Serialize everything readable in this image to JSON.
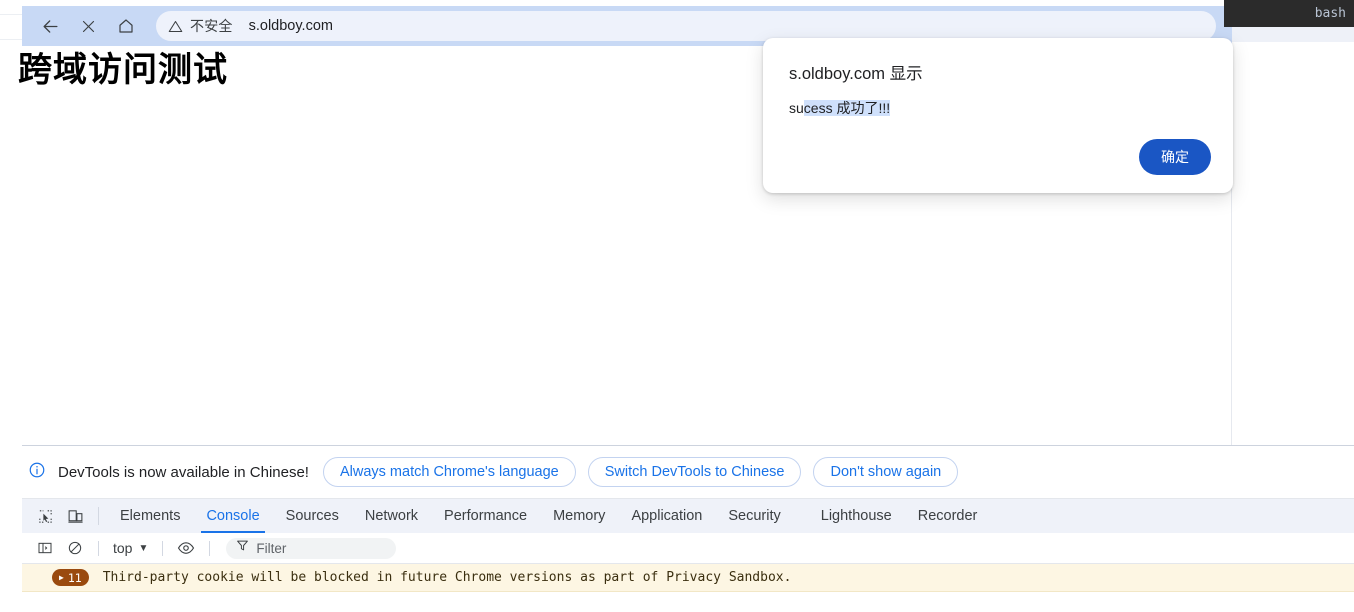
{
  "browser": {
    "back_icon": "back-arrow-icon",
    "close_icon": "close-icon",
    "home_icon": "home-icon",
    "security_icon": "warning-triangle-icon",
    "security_label": "不安全",
    "url": "s.oldboy.com",
    "toolbar_color": "#c8d9f5"
  },
  "terminal_overlay": {
    "label": "bash",
    "background": "#2b2b2b"
  },
  "page": {
    "title": "跨域访问测试"
  },
  "dialog": {
    "origin_line": "s.oldboy.com 显示",
    "message_plain": "su",
    "message_selected": "cess 成功了!!!",
    "message_full": "sucess 成功了!!!",
    "ok_label": "确定",
    "ok_color": "#1a56c4",
    "selection_color": "#cfe0fb"
  },
  "devtools": {
    "notice": {
      "icon": "info-circle-icon",
      "text": "DevTools is now available in Chinese!",
      "buttons": [
        {
          "label": "Always match Chrome's language"
        },
        {
          "label": "Switch DevTools to Chinese"
        },
        {
          "label": "Don't show again"
        }
      ]
    },
    "toolbar_icons": [
      {
        "name": "inspect-element-icon"
      },
      {
        "name": "device-toolbar-icon"
      }
    ],
    "tabs": [
      {
        "label": "Elements",
        "active": false
      },
      {
        "label": "Console",
        "active": true
      },
      {
        "label": "Sources",
        "active": false
      },
      {
        "label": "Network",
        "active": false
      },
      {
        "label": "Performance",
        "active": false
      },
      {
        "label": "Memory",
        "active": false
      },
      {
        "label": "Application",
        "active": false
      },
      {
        "label": "Security",
        "active": false
      },
      {
        "label": "Lighthouse",
        "active": false
      },
      {
        "label": "Recorder",
        "active": false
      }
    ],
    "console_bar": {
      "sidebar_icon": "console-sidebar-icon",
      "clear_icon": "clear-console-icon",
      "context": "top",
      "context_caret": "▼",
      "eye_icon": "live-expression-eye-icon",
      "filter_icon": "funnel-filter-icon",
      "filter_placeholder": "Filter"
    },
    "messages": [
      {
        "badge_count": "11",
        "badge_caret": "▶",
        "badge_color": "#9a4a0f",
        "text": "Third-party cookie will be blocked in future Chrome versions as part of Privacy Sandbox.",
        "background": "#fdf6e3"
      }
    ]
  }
}
